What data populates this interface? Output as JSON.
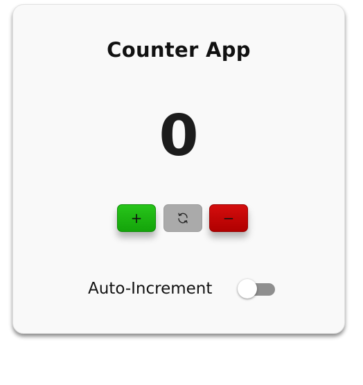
{
  "app": {
    "title": "Counter App"
  },
  "counter": {
    "value": "0"
  },
  "buttons": {
    "increment": {
      "label": "+",
      "icon": "plus-icon",
      "color": "#1fb812"
    },
    "reset": {
      "icon": "refresh-icon",
      "color": "#aaaaaa"
    },
    "decrement": {
      "label": "−",
      "icon": "minus-icon",
      "color": "#c20505"
    }
  },
  "auto_increment": {
    "label": "Auto-Increment",
    "enabled": false
  }
}
